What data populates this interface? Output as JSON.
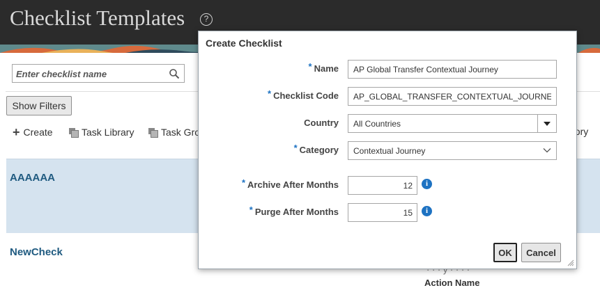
{
  "header": {
    "title": "Checklist Templates",
    "help_glyph": "?"
  },
  "search": {
    "placeholder": "Enter checklist name",
    "value": ""
  },
  "filters": {
    "show_filters_label": "Show Filters"
  },
  "toolbar": {
    "create_label": "Create",
    "task_library_label": "Task Library",
    "task_groups_label": "Task Gro",
    "right_clipped_label": "gory"
  },
  "rows": [
    {
      "name": "AAAAAA",
      "selected": true
    },
    {
      "name": "NewCheck",
      "selected": false
    }
  ],
  "background_text": {
    "partial_line": "· · ·  y  · · ·  ·",
    "action_name": "Action Name"
  },
  "dialog": {
    "title": "Create Checklist",
    "required_marker": "*",
    "fields": {
      "name": {
        "label": "Name",
        "value": "AP Global Transfer Contextual Journey"
      },
      "checklist_code": {
        "label": "Checklist Code",
        "value": "AP_GLOBAL_TRANSFER_CONTEXTUAL_JOURNEY"
      },
      "country": {
        "label": "Country",
        "value": "All Countries"
      },
      "category": {
        "label": "Category",
        "value": "Contextual Journey"
      },
      "archive_after_months": {
        "label": "Archive After Months",
        "value": "12"
      },
      "purge_after_months": {
        "label": "Purge After Months",
        "value": "15"
      }
    },
    "ok_label": "OK",
    "cancel_label": "Cancel"
  },
  "colors": {
    "header_bg": "#2b2b2b",
    "link": "#1f5a80",
    "selected_row": "#d5e3ef",
    "required_star": "#1d72c2",
    "info_icon": "#1d72c2"
  }
}
